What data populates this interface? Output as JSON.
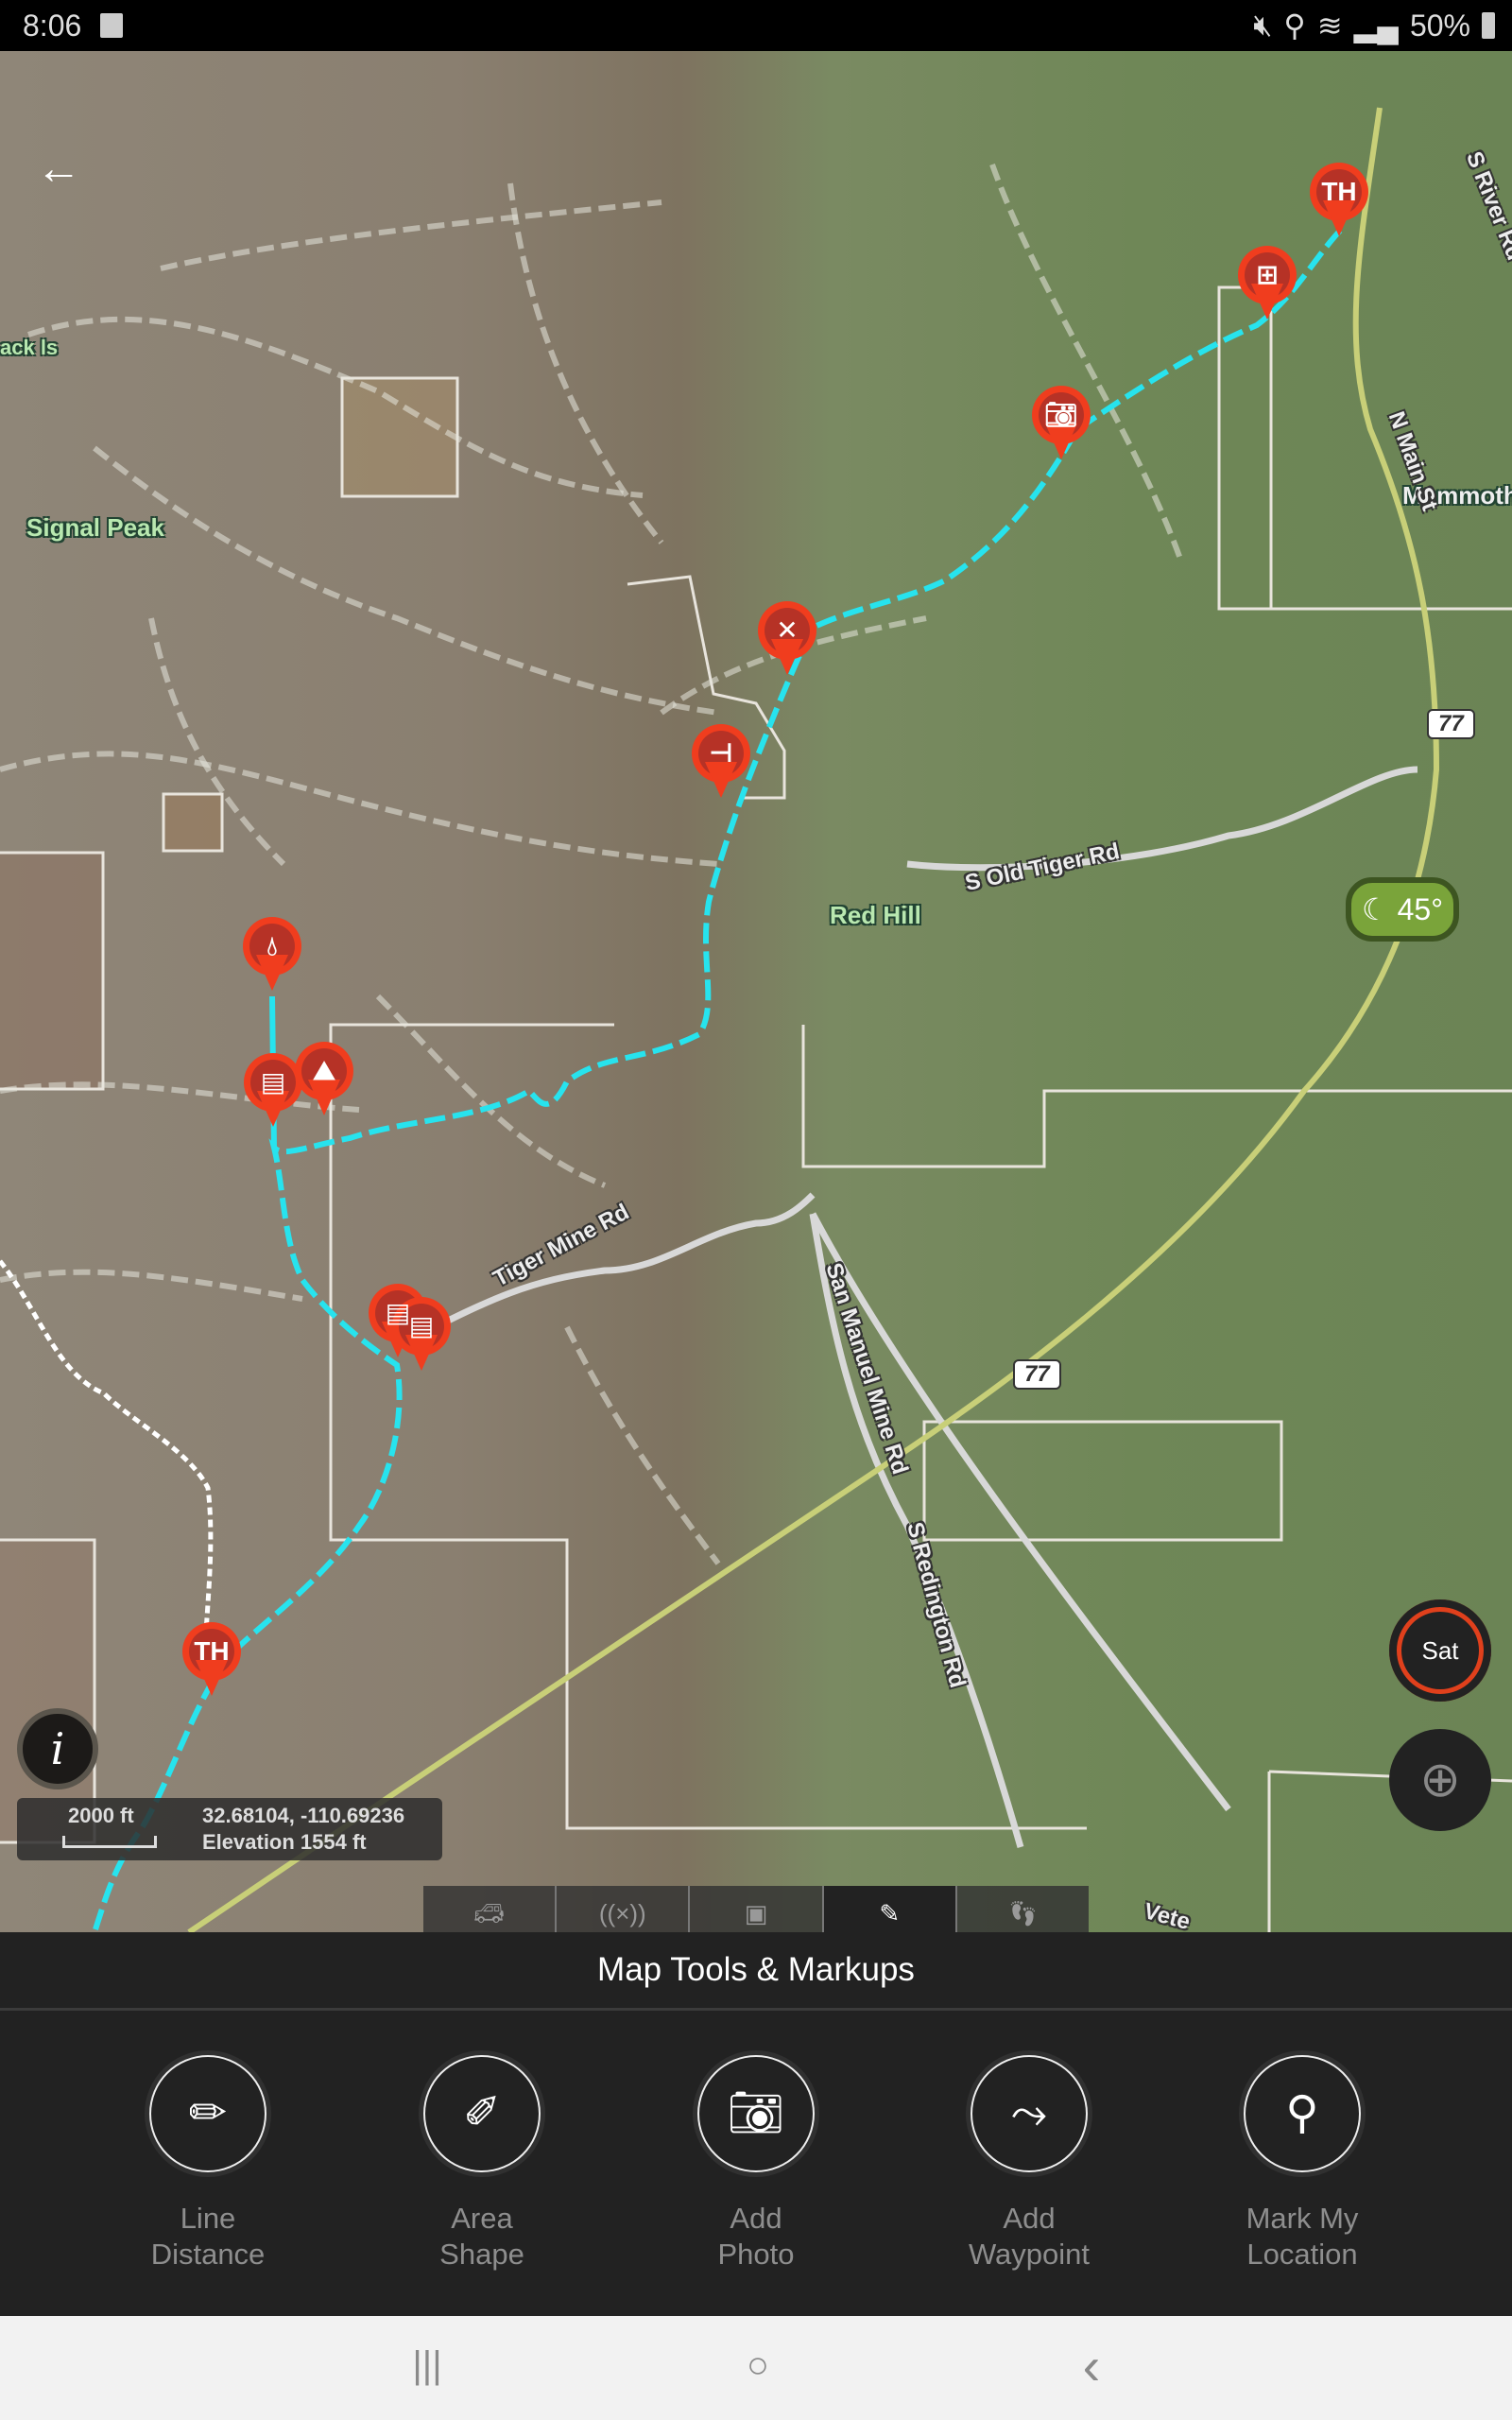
{
  "status_bar": {
    "time": "8:06",
    "battery": "50%",
    "icons": [
      "gallery-icon",
      "mute-icon",
      "location-icon",
      "wifi-icon",
      "signal-icon",
      "battery-icon"
    ]
  },
  "map": {
    "back_icon": "arrow-left-icon",
    "labels": {
      "signal_peak": "Signal Peak",
      "red_hill": "Red Hill",
      "partial_left": "ack ls",
      "marmot": "Mammoth"
    },
    "roads": {
      "old_tiger": "S Old Tiger Rd",
      "tiger_mine": "Tiger Mine Rd",
      "san_manuel": "San Manuel Mine Rd",
      "redington": "S Redington Rd",
      "main_st": "N Main St",
      "river_rd": "S River Rd",
      "vet": "Vete"
    },
    "highway_shields": [
      "77",
      "77"
    ],
    "markers": [
      {
        "type": "trailhead",
        "glyph": "TH"
      },
      {
        "type": "viewpoint",
        "glyph": "binoculars"
      },
      {
        "type": "photo",
        "glyph": "camera"
      },
      {
        "type": "closed",
        "glyph": "✕"
      },
      {
        "type": "signpost",
        "glyph": "signpost"
      },
      {
        "type": "water",
        "glyph": "water-drop"
      },
      {
        "type": "gate",
        "glyph": "gate"
      },
      {
        "type": "climbing",
        "glyph": "climber"
      },
      {
        "type": "gate",
        "glyph": "gate"
      },
      {
        "type": "gate",
        "glyph": "gate"
      },
      {
        "type": "trailhead",
        "glyph": "TH"
      }
    ],
    "weather": {
      "icon": "moon-icon",
      "temp": "45°"
    },
    "layer_button": "Sat",
    "locate_icon": "crosshair-icon",
    "info_label": "i",
    "scale": "2000 ft",
    "coordinates": "32.68104, -110.69236",
    "elevation": "Elevation 1554 ft",
    "trail_color": "#27e3ee",
    "marker_color": "#f03d1e"
  },
  "tabs": [
    {
      "label": "Rides",
      "icon": "jeep-icon",
      "active": false
    },
    {
      "label": "Off-Grid",
      "icon": "broadcast-icon",
      "active": false
    },
    {
      "label": "My Content",
      "icon": "folder-icon",
      "active": false
    },
    {
      "label": "Tools",
      "icon": "tools-icon",
      "active": true
    },
    {
      "label": "Tracker",
      "icon": "footprints-icon",
      "active": false
    }
  ],
  "panel": {
    "title": "Map Tools & Markups",
    "tools": [
      {
        "line1": "Line",
        "line2": "Distance",
        "icon": "pencil-line-icon"
      },
      {
        "line1": "Area",
        "line2": "Shape",
        "icon": "pencil-area-icon"
      },
      {
        "line1": "Add",
        "line2": "Photo",
        "icon": "camera-icon"
      },
      {
        "line1": "Add",
        "line2": "Waypoint",
        "icon": "route-icon"
      },
      {
        "line1": "Mark My",
        "line2": "Location",
        "icon": "map-pin-icon"
      }
    ]
  },
  "nav_bar": {
    "recents": "|||",
    "home": "○",
    "back": "‹"
  }
}
